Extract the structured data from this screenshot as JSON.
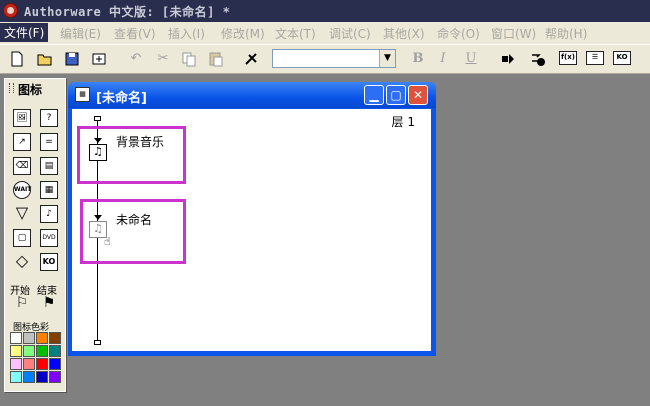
{
  "app": {
    "title": "Authorware 中文版: [未命名] *"
  },
  "menu": [
    "文件(F)",
    "编辑(E)",
    "查看(V)",
    "插入(I)",
    "修改(M)",
    "文本(T)",
    "调试(C)",
    "其他(X)",
    "命令(O)",
    "窗口(W)",
    "帮助(H)"
  ],
  "toolbar": {
    "bold": "B",
    "italic": "I",
    "underline": "U",
    "font_value": ""
  },
  "icon_panel": {
    "title": "图标",
    "start_label": "开始",
    "end_label": "结束",
    "color_label": "图标色彩",
    "icons": [
      "display-icon",
      "interaction-icon",
      "motion-icon",
      "calculation-icon",
      "erase-icon",
      "map-icon",
      "wait-icon",
      "digital-movie-icon",
      "navigate-icon",
      "sound-icon",
      "framework-icon",
      "dvd-video-icon",
      "decision-icon",
      "knowledge-object-icon"
    ],
    "colors": [
      "#ffffff",
      "#c0c0c0",
      "#ff8000",
      "#804000",
      "#ffff80",
      "#80ff80",
      "#00c000",
      "#008080",
      "#ffc0ff",
      "#ff8080",
      "#ff0000",
      "#0000ff",
      "#80ffff",
      "#0080ff",
      "#0000c0",
      "#8000ff"
    ]
  },
  "design_window": {
    "title": "[未命名]",
    "layer_label": "层 1",
    "nodes": [
      {
        "label": "背景音乐",
        "icon": "sound-icon"
      },
      {
        "label": "未命名",
        "icon": "sound-icon"
      }
    ]
  }
}
